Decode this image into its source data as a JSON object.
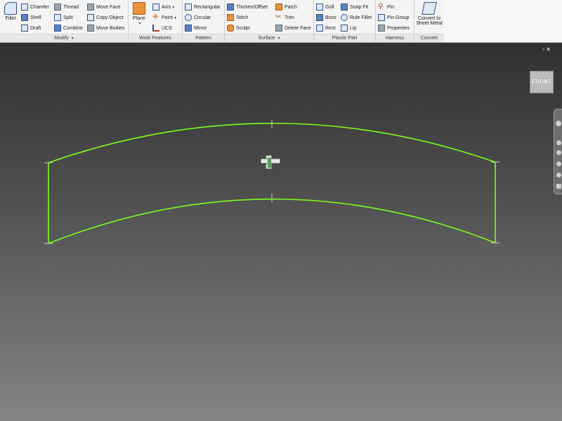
{
  "ribbon": {
    "modify": {
      "label": "Modify",
      "fillet": "Fillet",
      "chamfer": "Chamfer",
      "shell": "Shell",
      "draft": "Draft",
      "thread": "Thread",
      "split": "Split",
      "combine": "Combine",
      "move_face": "Move Face",
      "copy_object": "Copy Object",
      "move_bodies": "Move Bodies"
    },
    "work_features": {
      "label": "Work Features",
      "plane": "Plane",
      "axis": "Axis",
      "point": "Point",
      "ucs": "UCS"
    },
    "pattern": {
      "label": "Pattern",
      "rectangular": "Rectangular",
      "circular": "Circular",
      "mirror": "Mirror"
    },
    "surface": {
      "label": "Surface",
      "thicken_offset": "Thicken/Offset",
      "stitch": "Stitch",
      "sculpt": "Sculpt",
      "patch": "Patch",
      "trim": "Trim",
      "delete_face": "Delete Face"
    },
    "plastic_part": {
      "label": "Plastic Part",
      "grill": "Grill",
      "boss": "Boss",
      "rest": "Rest",
      "snap_fit": "Snap Fit",
      "rule_fillet": "Rule Fillet",
      "lip": "Lip"
    },
    "harness": {
      "label": "Harness",
      "pin": "Pin",
      "pin_group": "Pin Group",
      "properties": "Properties"
    },
    "convert": {
      "label": "Convert",
      "convert_line1": "Convert to",
      "convert_line2": "Sheet Metal"
    }
  },
  "viewport": {
    "viewcube_label": "FRONT",
    "sketch_color": "#7cff1f",
    "background_top": "#313131",
    "background_bottom": "#848484"
  }
}
